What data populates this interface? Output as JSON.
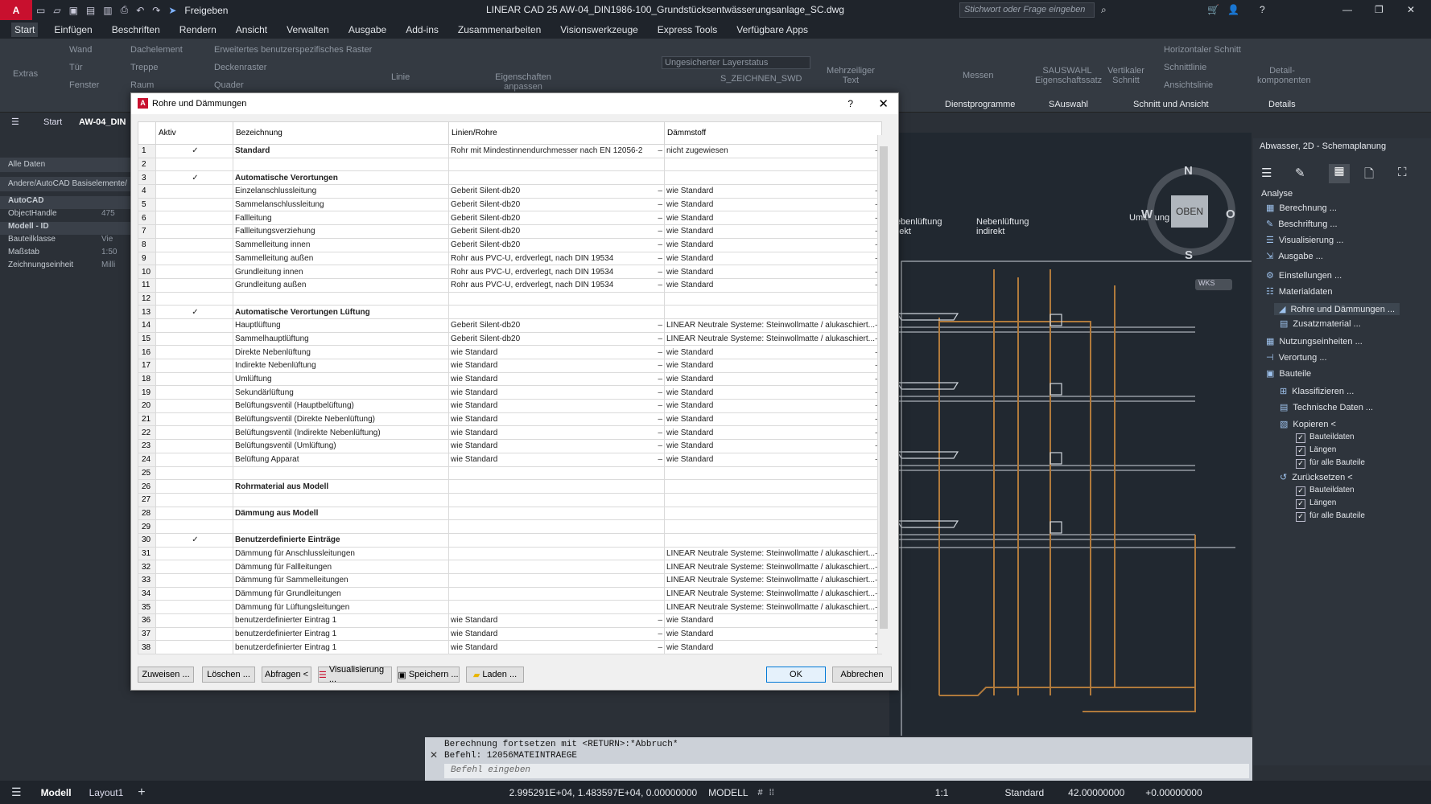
{
  "titlebar": {
    "logo": "A",
    "share_label": "Freigeben",
    "title": "LINEAR CAD 25   AW-04_DIN1986-100_Grundstücksentwässerungsanlage_SC.dwg",
    "search_placeholder": "Stichwort oder Frage eingeben"
  },
  "menu": [
    "Start",
    "Einfügen",
    "Beschriften",
    "Rendern",
    "Ansicht",
    "Verwalten",
    "Ausgabe",
    "Add-ins",
    "Zusammenarbeiten",
    "Visionswerkzeuge",
    "Express Tools",
    "Verfügbare Apps"
  ],
  "ribbon": {
    "extras": "Extras",
    "wand": "Wand",
    "tuer": "Tür",
    "fenster": "Fenster",
    "dachelement": "Dachelement",
    "treppe": "Treppe",
    "raum": "Raum",
    "raster": "Erweitertes benutzerspezifisches Raster",
    "deckenraster": "Deckenraster",
    "quader": "Quader",
    "linie": "Linie",
    "eigenschaften": "Eigenschaften anpassen",
    "layerstatus": "Ungesicherter Layerstatus",
    "layer": "S_ZEICHNEN_SWD",
    "mehrzeilig": "Mehrzeiliger Text",
    "messen": "Messen",
    "dienstprogramme": "Dienstprogramme",
    "sauswahl": "SAUSWAHL Eigenschaftssatz",
    "sauswahl_group": "SAuswahl",
    "vertikaler": "Vertikaler Schnitt",
    "horizontaler": "Horizontaler Schnitt",
    "schnittlinie": "Schnittlinie",
    "ansichtslinie": "Ansichtslinie",
    "schnitt_group": "Schnitt und Ansicht",
    "detail": "Detail-komponenten",
    "details_group": "Details"
  },
  "filetabs": {
    "start": "Start",
    "doc": "AW-04_DIN"
  },
  "leftpanel": {
    "all": "Alle Daten",
    "path": "Andere/AutoCAD Basiselemente/",
    "rows": [
      {
        "label": "AutoCAD",
        "value": ""
      },
      {
        "label": "ObjectHandle",
        "value": "475"
      },
      {
        "label": "Modell - ID",
        "value": ""
      },
      {
        "label": "Bauteilklasse",
        "value": "Vie"
      },
      {
        "label": "Maßstab",
        "value": "1:50"
      },
      {
        "label": "Zeichnungseinheit",
        "value": "Milli"
      }
    ]
  },
  "dialog": {
    "title": "Rohre und Dämmungen",
    "help": "?",
    "columns": [
      "Aktiv",
      "Bezeichnung",
      "Linien/Rohre",
      "Dämmstoff"
    ],
    "rows": [
      {
        "n": "1",
        "active": "✓",
        "name": "Standard",
        "bold": true,
        "pipe": "Rohr mit Mindestinnendurchmesser nach EN 12056-2",
        "insul": "nicht zugewiesen"
      },
      {
        "n": "2",
        "active": "",
        "name": "",
        "bold": false,
        "pipe": "",
        "insul": ""
      },
      {
        "n": "3",
        "active": "✓",
        "name": "Automatische Verortungen",
        "bold": true,
        "pipe": "",
        "insul": ""
      },
      {
        "n": "4",
        "active": "",
        "name": "Einzelanschlussleitung",
        "bold": false,
        "pipe": "Geberit Silent-db20",
        "insul": "wie Standard"
      },
      {
        "n": "5",
        "active": "",
        "name": "Sammelanschlussleitung",
        "bold": false,
        "pipe": "Geberit Silent-db20",
        "insul": "wie Standard"
      },
      {
        "n": "6",
        "active": "",
        "name": "Fallleitung",
        "bold": false,
        "pipe": "Geberit Silent-db20",
        "insul": "wie Standard"
      },
      {
        "n": "7",
        "active": "",
        "name": "Fallleitungsverziehung",
        "bold": false,
        "pipe": "Geberit Silent-db20",
        "insul": "wie Standard"
      },
      {
        "n": "8",
        "active": "",
        "name": "Sammelleitung innen",
        "bold": false,
        "pipe": "Geberit Silent-db20",
        "insul": "wie Standard"
      },
      {
        "n": "9",
        "active": "",
        "name": "Sammelleitung außen",
        "bold": false,
        "pipe": "Rohr aus PVC-U, erdverlegt, nach DIN 19534",
        "insul": "wie Standard"
      },
      {
        "n": "10",
        "active": "",
        "name": "Grundleitung innen",
        "bold": false,
        "pipe": "Rohr aus PVC-U, erdverlegt, nach DIN 19534",
        "insul": "wie Standard"
      },
      {
        "n": "11",
        "active": "",
        "name": "Grundleitung außen",
        "bold": false,
        "pipe": "Rohr aus PVC-U, erdverlegt, nach DIN 19534",
        "insul": "wie Standard"
      },
      {
        "n": "12",
        "active": "",
        "name": "",
        "bold": false,
        "pipe": "",
        "insul": ""
      },
      {
        "n": "13",
        "active": "✓",
        "name": "Automatische Verortungen Lüftung",
        "bold": true,
        "pipe": "",
        "insul": ""
      },
      {
        "n": "14",
        "active": "",
        "name": "Hauptlüftung",
        "bold": false,
        "pipe": "Geberit Silent-db20",
        "insul": "LINEAR Neutrale Systeme: Steinwollmatte / alukaschiert..."
      },
      {
        "n": "15",
        "active": "",
        "name": "Sammelhauptlüftung",
        "bold": false,
        "pipe": "Geberit Silent-db20",
        "insul": "LINEAR Neutrale Systeme: Steinwollmatte / alukaschiert..."
      },
      {
        "n": "16",
        "active": "",
        "name": "Direkte Nebenlüftung",
        "bold": false,
        "pipe": "wie Standard",
        "insul": "wie Standard"
      },
      {
        "n": "17",
        "active": "",
        "name": "Indirekte Nebenlüftung",
        "bold": false,
        "pipe": "wie Standard",
        "insul": "wie Standard"
      },
      {
        "n": "18",
        "active": "",
        "name": "Umlüftung",
        "bold": false,
        "pipe": "wie Standard",
        "insul": "wie Standard"
      },
      {
        "n": "19",
        "active": "",
        "name": "Sekundärlüftung",
        "bold": false,
        "pipe": "wie Standard",
        "insul": "wie Standard"
      },
      {
        "n": "20",
        "active": "",
        "name": "Belüftungsventil (Hauptbelüftung)",
        "bold": false,
        "pipe": "wie Standard",
        "insul": "wie Standard"
      },
      {
        "n": "21",
        "active": "",
        "name": "Belüftungsventil (Direkte Nebenlüftung)",
        "bold": false,
        "pipe": "wie Standard",
        "insul": "wie Standard"
      },
      {
        "n": "22",
        "active": "",
        "name": "Belüftungsventil (Indirekte Nebenlüftung)",
        "bold": false,
        "pipe": "wie Standard",
        "insul": "wie Standard"
      },
      {
        "n": "23",
        "active": "",
        "name": "Belüftungsventil (Umlüftung)",
        "bold": false,
        "pipe": "wie Standard",
        "insul": "wie Standard"
      },
      {
        "n": "24",
        "active": "",
        "name": "Belüftung Apparat",
        "bold": false,
        "pipe": "wie Standard",
        "insul": "wie Standard"
      },
      {
        "n": "25",
        "active": "",
        "name": "",
        "bold": false,
        "pipe": "",
        "insul": ""
      },
      {
        "n": "26",
        "active": "",
        "name": "Rohrmaterial aus Modell",
        "bold": true,
        "pipe": "",
        "insul": ""
      },
      {
        "n": "27",
        "active": "",
        "name": "",
        "bold": false,
        "pipe": "",
        "insul": ""
      },
      {
        "n": "28",
        "active": "",
        "name": "Dämmung aus Modell",
        "bold": true,
        "pipe": "",
        "insul": ""
      },
      {
        "n": "29",
        "active": "",
        "name": "",
        "bold": false,
        "pipe": "",
        "insul": ""
      },
      {
        "n": "30",
        "active": "✓",
        "name": "Benutzerdefinierte Einträge",
        "bold": true,
        "pipe": "",
        "insul": ""
      },
      {
        "n": "31",
        "active": "",
        "name": "Dämmung für Anschlussleitungen",
        "bold": false,
        "pipe": "",
        "insul": "LINEAR Neutrale Systeme: Steinwollmatte / alukaschiert..."
      },
      {
        "n": "32",
        "active": "",
        "name": "Dämmung für Fallleitungen",
        "bold": false,
        "pipe": "",
        "insul": "LINEAR Neutrale Systeme: Steinwollmatte / alukaschiert..."
      },
      {
        "n": "33",
        "active": "",
        "name": "Dämmung für Sammelleitungen",
        "bold": false,
        "pipe": "",
        "insul": "LINEAR Neutrale Systeme: Steinwollmatte / alukaschiert..."
      },
      {
        "n": "34",
        "active": "",
        "name": "Dämmung für Grundleitungen",
        "bold": false,
        "pipe": "",
        "insul": "LINEAR Neutrale Systeme: Steinwollmatte / alukaschiert..."
      },
      {
        "n": "35",
        "active": "",
        "name": "Dämmung für Lüftungsleitungen",
        "bold": false,
        "pipe": "",
        "insul": "LINEAR Neutrale Systeme: Steinwollmatte / alukaschiert..."
      },
      {
        "n": "36",
        "active": "",
        "name": "benutzerdefinierter Eintrag 1",
        "bold": false,
        "pipe": "wie Standard",
        "insul": "wie Standard"
      },
      {
        "n": "37",
        "active": "",
        "name": "benutzerdefinierter Eintrag 1",
        "bold": false,
        "pipe": "wie Standard",
        "insul": "wie Standard"
      },
      {
        "n": "38",
        "active": "",
        "name": "benutzerdefinierter Eintrag 1",
        "bold": false,
        "pipe": "wie Standard",
        "insul": "wie Standard"
      }
    ],
    "buttons": {
      "zuweisen": "Zuweisen ...",
      "loeschen": "Löschen ...",
      "abfragen": "Abfragen <",
      "visualisierung": "Visualisierung ...",
      "speichern": "Speichern ...",
      "laden": "Laden ...",
      "ok": "OK",
      "abbrechen": "Abbrechen"
    }
  },
  "drawing": {
    "labels": [
      "Nebenlüftung direkt",
      "Nebenlüftung indirekt",
      "Umlüftung"
    ],
    "compass": {
      "n": "N",
      "s": "S",
      "w": "W",
      "o": "O",
      "top": "OBEN"
    },
    "wks": "WKS"
  },
  "rightpanel": {
    "header": "Abwasser, 2D - Schemaplanung",
    "section": "Analyse",
    "items": [
      "Berechnung ...",
      "Beschriftung ...",
      "Visualisierung ...",
      "Ausgabe ...",
      "Einstellungen ...",
      "Materialdaten",
      "Rohre und Dämmungen ...",
      "Zusatzmaterial ...",
      "Nutzungseinheiten ...",
      "Verortung ...",
      "Bauteile",
      "Klassifizieren ...",
      "Technische Daten ...",
      "Kopieren <",
      "Bauteildaten",
      "Längen",
      "für alle Bauteile",
      "Zurücksetzen <",
      "Bauteildaten",
      "Längen",
      "für alle Bauteile"
    ]
  },
  "cmdline": {
    "line1": "Berechnung fortsetzen mit <RETURN>:*Abbruch*",
    "line2": "Befehl: 12056MATEINTRAEGE",
    "placeholder": "Befehl eingeben"
  },
  "statusbar": {
    "modell": "Modell",
    "layout": "Layout1",
    "coords": "2.995291E+04, 1.483597E+04, 0.00000000",
    "mode": "MODELL",
    "scale": "1:1",
    "standard": "Standard",
    "value1": "42.00000000",
    "value2": "+0.00000000"
  },
  "colors": {
    "accent": "#0078d7",
    "pipe": "#b07a3c",
    "logo": "#c8102e"
  }
}
